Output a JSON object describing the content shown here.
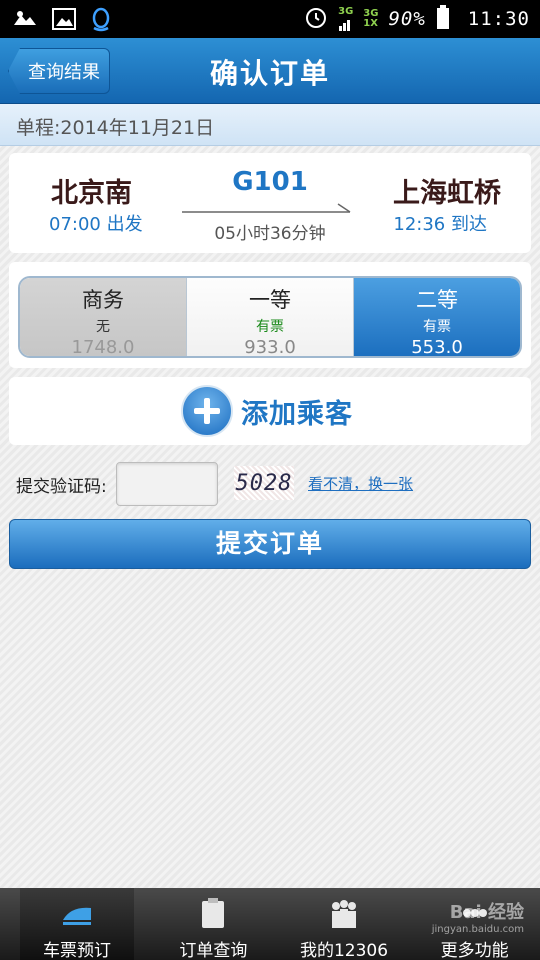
{
  "status_bar": {
    "battery": "90%",
    "time": "11:30",
    "net_primary": "3G",
    "net_secondary_top": "3G",
    "net_secondary_bottom": "1X"
  },
  "header": {
    "back_label": "查询结果",
    "title": "确认订单"
  },
  "trip": {
    "date_line": "单程:2014年11月21日",
    "from_station": "北京南",
    "depart_time": "07:00 出发",
    "train_no": "G101",
    "duration": "05小时36分钟",
    "to_station": "上海虹桥",
    "arrive_time": "12:36 到达"
  },
  "seats": [
    {
      "name": "商务",
      "availability": "无",
      "price": "1748.0",
      "state": "disabled"
    },
    {
      "name": "一等",
      "availability": "有票",
      "price": "933.0",
      "state": "normal"
    },
    {
      "name": "二等",
      "availability": "有票",
      "price": "553.0",
      "state": "selected"
    }
  ],
  "add_passenger": {
    "label": "添加乘客"
  },
  "captcha": {
    "label": "提交验证码:",
    "value": "",
    "code": "5028",
    "refresh_link": "看不清，换一张"
  },
  "submit": {
    "label": "提交订单"
  },
  "bottom_nav": {
    "items": [
      {
        "label": "车票预订",
        "icon": "train-icon",
        "active": true
      },
      {
        "label": "订单查询",
        "icon": "clipboard-icon",
        "active": false
      },
      {
        "label": "我的12306",
        "icon": "people-icon",
        "active": false
      },
      {
        "label": "更多功能",
        "icon": "more-icon",
        "active": false
      }
    ]
  },
  "watermark": {
    "brand": "Bai 经验",
    "url": "jingyan.baidu.com"
  },
  "colors": {
    "accent": "#1f76c4",
    "title_bar": "#1a6cb8",
    "available_green": "#1a8a1a"
  }
}
